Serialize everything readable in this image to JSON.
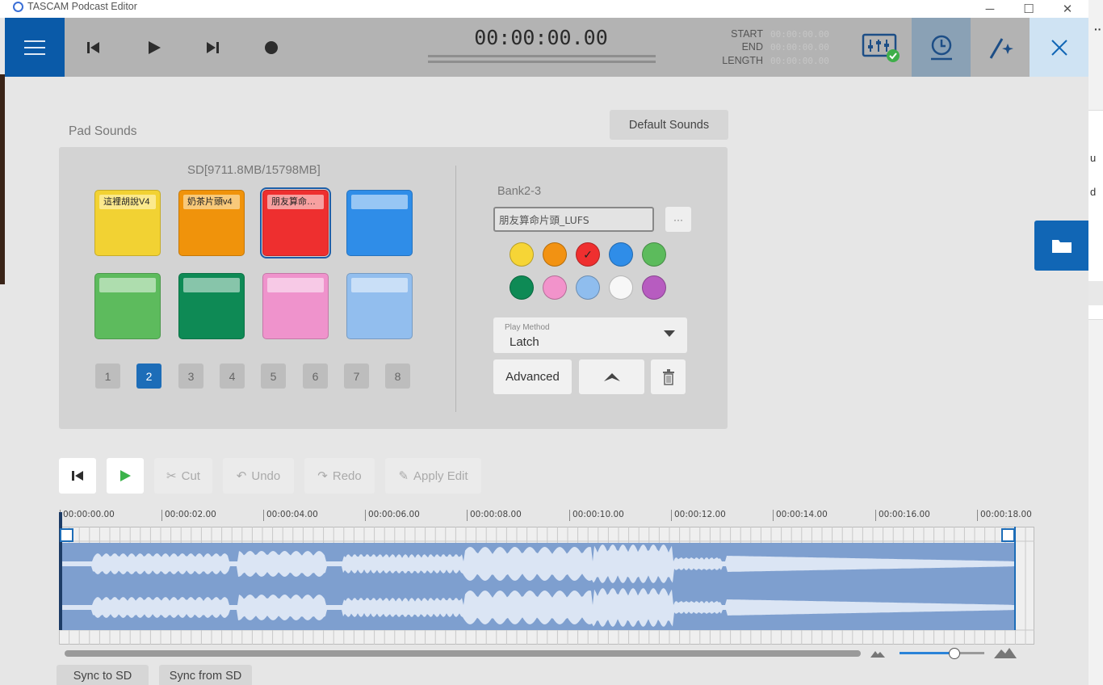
{
  "window": {
    "title": "TASCAM Podcast Editor"
  },
  "transport": {
    "timecode": "00:00:00.00",
    "start_label": "START",
    "start_value": "00:00:00.00",
    "end_label": "END",
    "end_value": "00:00:00.00",
    "length_label": "LENGTH",
    "length_value": "00:00:00.00"
  },
  "pad_sounds": {
    "title": "Pad Sounds",
    "default_button": "Default Sounds",
    "sd_info": "SD[9711.8MB/15798MB]",
    "pads": [
      {
        "label": "這裡胡說V4",
        "color": "#f2d233"
      },
      {
        "label": "奶茶片頭v4",
        "color": "#f0930b"
      },
      {
        "label": "朋友算命片頭_LUFS",
        "color": "#ee2f2f",
        "selected": true
      },
      {
        "label": "",
        "color": "#2f8de8"
      },
      {
        "label": "",
        "color": "#5dbb5d"
      },
      {
        "label": "",
        "color": "#0e8a55"
      },
      {
        "label": "",
        "color": "#ef93cc"
      },
      {
        "label": "",
        "color": "#92beee"
      }
    ],
    "banks": [
      "1",
      "2",
      "3",
      "4",
      "5",
      "6",
      "7",
      "8"
    ],
    "active_bank": "2"
  },
  "pad_editor": {
    "bank_label": "Bank2-3",
    "name_value": "朋友算命片頭_LUFS",
    "more_label": "···",
    "colors": [
      "#f6d536",
      "#f29212",
      "#ef2f2f",
      "#2f8de8",
      "#5cbb5c",
      "#0e8a55",
      "#f293cb",
      "#8fbdee",
      "#f7f7f7",
      "#b75cc0"
    ],
    "selected_color_index": 2,
    "check_mark": "✓",
    "play_method_label": "Play Method",
    "play_method_value": "Latch",
    "advanced_label": "Advanced"
  },
  "edit_toolbar": {
    "cut": "Cut",
    "undo": "Undo",
    "redo": "Redo",
    "apply": "Apply Edit"
  },
  "timeline": {
    "ticks": [
      "00:00:00.00",
      "00:00:02.00",
      "00:00:04.00",
      "00:00:06.00",
      "00:00:08.00",
      "00:00:10.00",
      "00:00:12.00",
      "00:00:14.00",
      "00:00:16.00",
      "00:00:18.00"
    ]
  },
  "sync": {
    "to_sd": "Sync to SD",
    "from_sd": "Sync from SD"
  },
  "background_window": {
    "text_1": "u",
    "text_2": "d",
    "dots": "··"
  }
}
